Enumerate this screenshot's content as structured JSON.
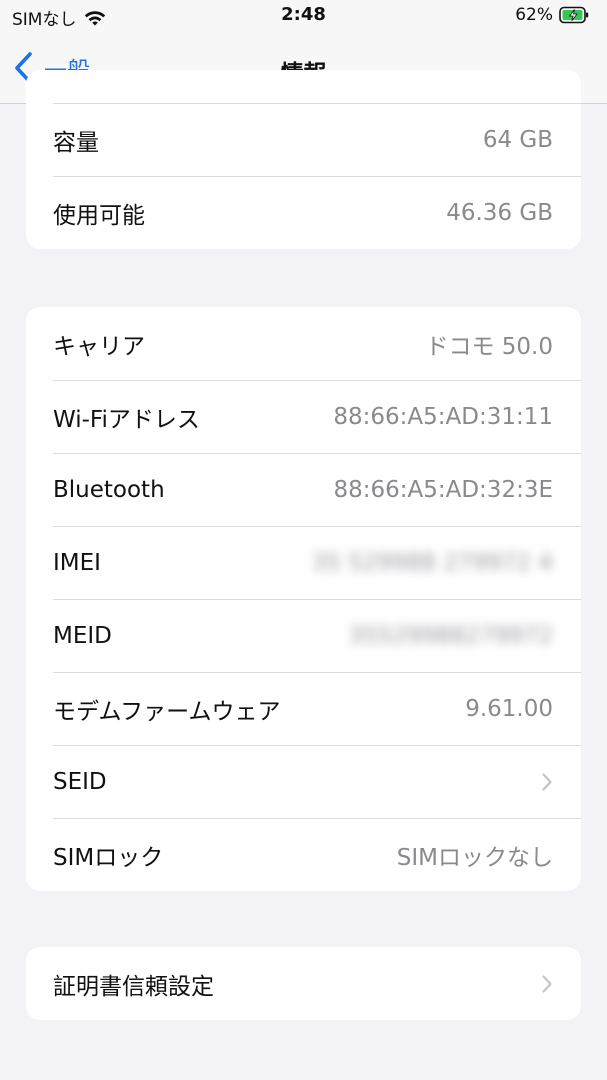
{
  "status_bar": {
    "carrier": "SIMなし",
    "time": "2:48",
    "battery": "62%"
  },
  "nav": {
    "back_label": "一般",
    "title": "情報"
  },
  "storage_group": [
    {
      "label": "容量",
      "value": "64 GB"
    },
    {
      "label": "使用可能",
      "value": "46.36 GB"
    }
  ],
  "network_group": [
    {
      "label": "キャリア",
      "value": "ドコモ 50.0"
    },
    {
      "label": "Wi-Fiアドレス",
      "value": "88:66:A5:AD:31:11"
    },
    {
      "label": "Bluetooth",
      "value": "88:66:A5:AD:32:3E"
    },
    {
      "label": "IMEI",
      "value": "35 529988 279972 4"
    },
    {
      "label": "MEID",
      "value": "35529988279972"
    },
    {
      "label": "モデムファームウェア",
      "value": "9.61.00"
    },
    {
      "label": "SEID",
      "value": ""
    },
    {
      "label": "SIMロック",
      "value": "SIMロックなし"
    }
  ],
  "cert_group": [
    {
      "label": "証明書信頼設定"
    }
  ],
  "icons": {
    "wifi": "wifi-icon",
    "battery": "battery-charging-icon",
    "back": "chevron-left-icon",
    "disclosure": "chevron-right-icon"
  },
  "colors": {
    "accent": "#1a73e8",
    "battery_fill": "#34c759",
    "background": "#f2f2f7"
  }
}
